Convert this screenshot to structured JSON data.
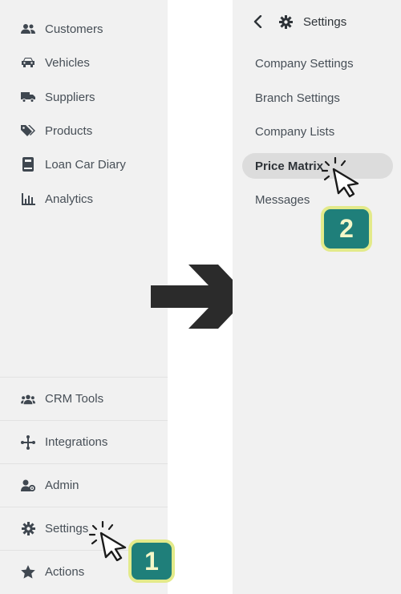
{
  "left_sidebar": {
    "items": [
      {
        "label": "Customers",
        "icon": "users-icon"
      },
      {
        "label": "Vehicles",
        "icon": "car-icon"
      },
      {
        "label": "Suppliers",
        "icon": "truck-icon"
      },
      {
        "label": "Products",
        "icon": "tags-icon"
      },
      {
        "label": "Loan Car Diary",
        "icon": "diary-icon"
      },
      {
        "label": "Analytics",
        "icon": "chart-icon"
      }
    ],
    "bottom_items": [
      {
        "label": "CRM Tools",
        "icon": "users-group-icon"
      },
      {
        "label": "Integrations",
        "icon": "integrations-icon"
      },
      {
        "label": "Admin",
        "icon": "admin-icon"
      },
      {
        "label": "Settings",
        "icon": "gear-icon"
      },
      {
        "label": "Actions",
        "icon": "star-icon"
      }
    ]
  },
  "settings_panel": {
    "title": "Settings",
    "items": [
      {
        "label": "Company Settings"
      },
      {
        "label": "Branch Settings"
      },
      {
        "label": "Company Lists"
      },
      {
        "label": "Price Matrix",
        "active": true
      },
      {
        "label": "Messages"
      }
    ]
  },
  "steps": {
    "step1": "1",
    "step2": "2"
  },
  "colors": {
    "panel_bg": "#f1f1f1",
    "text": "#474f57",
    "active_bg": "#dcdcdc",
    "badge_bg": "#1f7f7a",
    "badge_border": "#e3ea8a",
    "arrow": "#2b2b2b"
  }
}
